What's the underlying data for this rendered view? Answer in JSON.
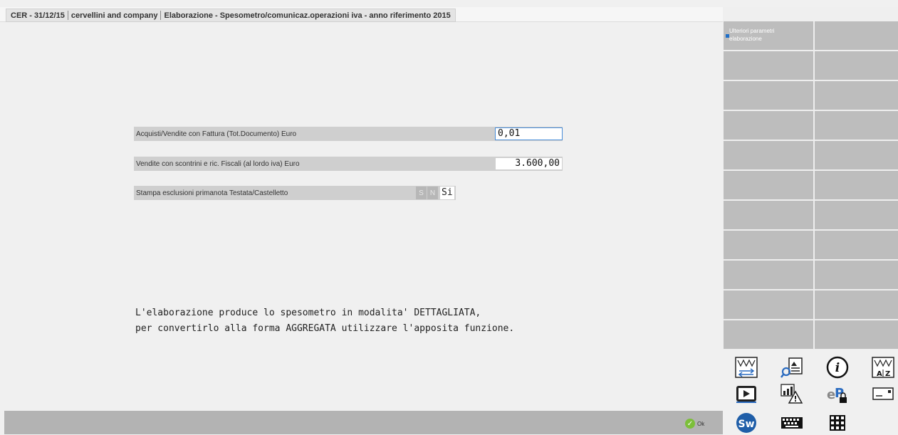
{
  "titlebar": {
    "company_code": "CER - 31/12/15",
    "company_name": "cervellini and company",
    "window_title": "Elaborazione - Spesometro/comunicaz.operazioni iva - anno riferimento 2015"
  },
  "form": {
    "field1_label": "Acquisti/Vendite con Fattura (Tot.Documento) Euro",
    "field1_value": "0,01",
    "field2_label": "Vendite con scontrini e ric. Fiscali (al lordo iva) Euro",
    "field2_value": "3.600,00",
    "field3_label": "Stampa esclusioni primanota Testata/Castelletto",
    "field3_opt_s": "S",
    "field3_opt_n": "N",
    "field3_value": "Si"
  },
  "message": {
    "line1": "L'elaborazione produce lo spesometro in modalita' DETTAGLIATA,",
    "line2": "per convertirlo alla forma AGGREGATA utilizzare l'apposita funzione."
  },
  "statusbar": {
    "ok_label": "Ok"
  },
  "right_panel": {
    "param_button_line1": "Ulteriori parametri",
    "param_button_line2": "elaborazione"
  },
  "icons": [
    "import-export-icon",
    "search-document-icon",
    "info-icon",
    "sort-az-icon",
    "video-play-icon",
    "chart-warning-icon",
    "ep-lock-icon",
    "card-reader-icon",
    "sw-logo-icon",
    "keyboard-icon",
    "grid-keypad-icon"
  ],
  "colors": {
    "focus_border": "#4a8ed8",
    "panel_button": "#bdbdbd",
    "accent_blue": "#1f6fc8",
    "ok_green": "#7cbf3a"
  }
}
